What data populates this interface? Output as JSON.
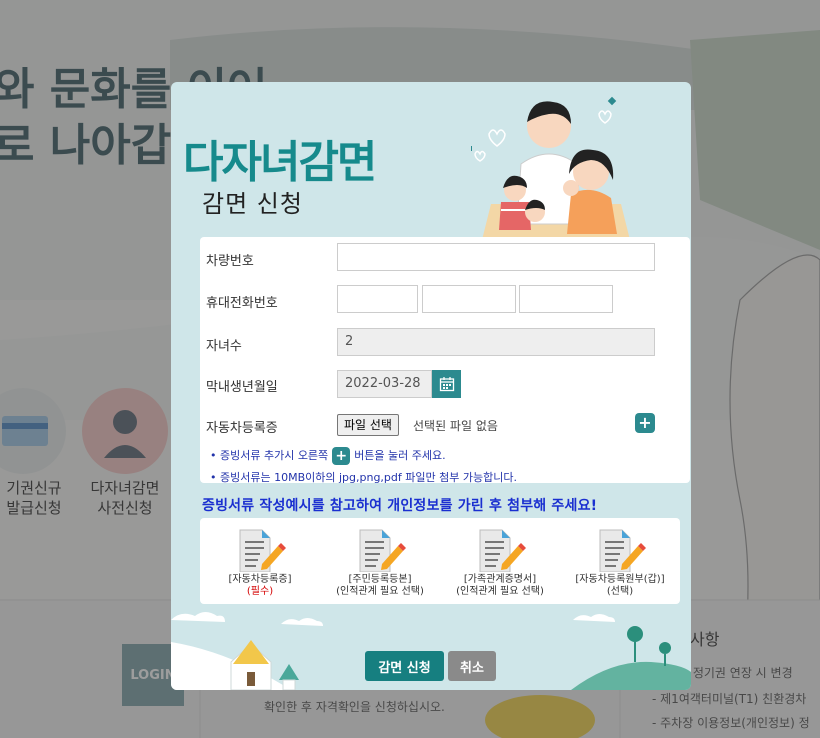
{
  "background": {
    "hero_line1": "와 문화를 이어",
    "hero_line2": "로 나아갑",
    "quick_links": [
      {
        "line1": "기권신규",
        "line2": "발급신청"
      },
      {
        "line1": "다자녀감면",
        "line2": "사전신청"
      }
    ],
    "login_label": "LOGIN",
    "notice_title": "사항",
    "notice_items": [
      "관 정기권 연장 시 변경",
      "- 제1여객터미널(T1) 친환경차",
      "- 주차장 이용정보(개인정보) 정"
    ],
    "bottom_text": "확인한 후 자격확인을 신청하십시오."
  },
  "modal": {
    "title": "다자녀감면",
    "subtitle": "감면 신청",
    "fields": {
      "vehicle_label": "차량번호",
      "vehicle_value": "",
      "phone_label": "휴대전화번호",
      "phone_values": [
        "",
        "",
        ""
      ],
      "children_label": "자녀수",
      "children_value": "2",
      "birth_label": "막내생년월일",
      "birth_value": "2022-03-28",
      "registration_label": "자동차등록증",
      "file_button": "파일 선택",
      "file_status": "선택된 파일 없음"
    },
    "notes": {
      "note1_before": "• 증빙서류 추가시 오른쪽",
      "note1_after": "버튼을 눌러 주세요.",
      "note2": "• 증빙서류는 10MB이하의 jpg,png,pdf 파일만 첨부 가능합니다."
    },
    "notice": "증빙서류 작성예시를 참고하여 개인정보를 가린 후 첨부해 주세요!",
    "documents": [
      {
        "label": "[자동차등록증]",
        "sub": "(필수)"
      },
      {
        "label": "[주민등록등본]",
        "sub": "(인적관계 필요 선택)"
      },
      {
        "label": "[가족관계증명서]",
        "sub": "(인적관계 필요 선택)"
      },
      {
        "label": "[자동차등록원부(갑)]",
        "sub": "(선택)"
      }
    ],
    "apply_button": "감면 신청",
    "cancel_button": "취소"
  },
  "colors": {
    "accent": "#2c8a8f",
    "title": "#168a8c",
    "notice": "#1a2fd0",
    "required": "#d40000"
  }
}
